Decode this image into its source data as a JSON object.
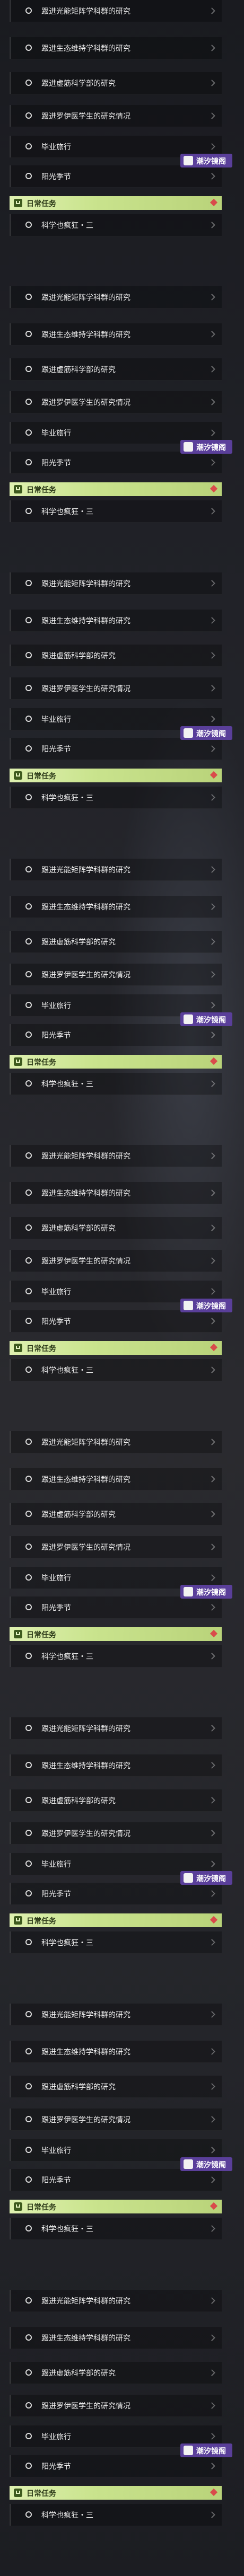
{
  "quest_list": {
    "items": [
      "跟进光能矩阵学科群的研究",
      "跟进生态维持学科群的研究",
      "跟进虚筋科学部的研究",
      "跟进罗伊医学生的研究情况",
      "毕业旅行",
      "阳光季节"
    ],
    "section_title": "日常任务",
    "daily_item": "科学也疯狂・三"
  },
  "watermark": {
    "text": "潮汐镜阁"
  },
  "colors": {
    "section_bg": "#c9e38d",
    "alert_diamond": "#d94b4b",
    "watermark_bg": "#5a3f9a"
  }
}
